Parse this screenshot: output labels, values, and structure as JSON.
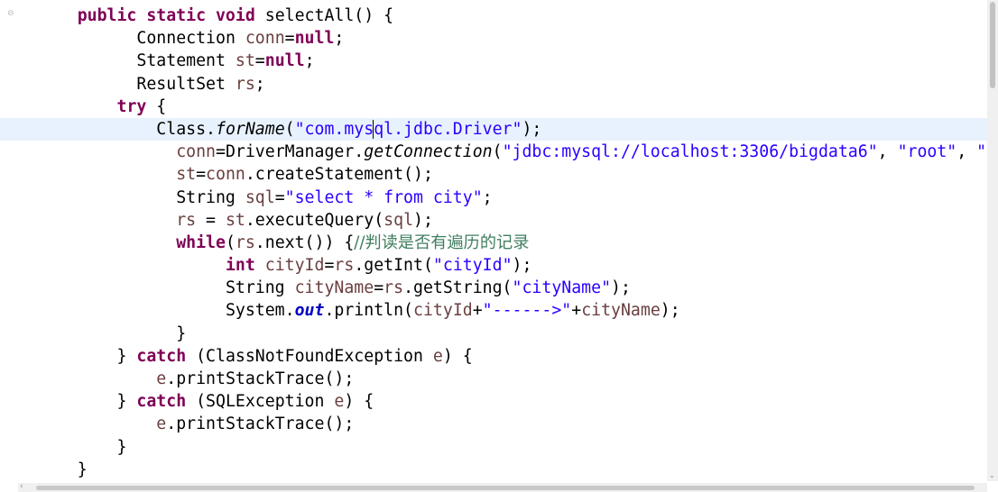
{
  "editor": {
    "gutter_marker": "⊖",
    "caret_line": 4,
    "lines": [
      {
        "indent": 6,
        "tokens": [
          {
            "t": "public static void",
            "c": "kw"
          },
          {
            "t": " selectAll() {",
            "c": ""
          }
        ]
      },
      {
        "indent": 12,
        "tokens": [
          {
            "t": "Connection ",
            "c": ""
          },
          {
            "t": "conn",
            "c": "var"
          },
          {
            "t": "=",
            "c": ""
          },
          {
            "t": "null",
            "c": "kw"
          },
          {
            "t": ";",
            "c": ""
          }
        ]
      },
      {
        "indent": 12,
        "tokens": [
          {
            "t": "Statement ",
            "c": ""
          },
          {
            "t": "st",
            "c": "var"
          },
          {
            "t": "=",
            "c": ""
          },
          {
            "t": "null",
            "c": "kw"
          },
          {
            "t": ";",
            "c": ""
          }
        ]
      },
      {
        "indent": 12,
        "tokens": [
          {
            "t": "ResultSet ",
            "c": ""
          },
          {
            "t": "rs",
            "c": "var"
          },
          {
            "t": ";",
            "c": ""
          }
        ]
      },
      {
        "indent": 10,
        "tokens": [
          {
            "t": "try",
            "c": "kw"
          },
          {
            "t": " {",
            "c": ""
          }
        ]
      },
      {
        "indent": 14,
        "current": true,
        "tokens": [
          {
            "t": "Class.",
            "c": ""
          },
          {
            "t": "forName",
            "c": "static-call"
          },
          {
            "t": "(",
            "c": ""
          },
          {
            "t": "\"com.mysql.jdbc.Driver\"",
            "c": "str"
          },
          {
            "t": ");",
            "c": ""
          }
        ]
      },
      {
        "indent": 16,
        "tokens": [
          {
            "t": "conn",
            "c": "var"
          },
          {
            "t": "=DriverManager.",
            "c": ""
          },
          {
            "t": "getConnection",
            "c": "static-call"
          },
          {
            "t": "(",
            "c": ""
          },
          {
            "t": "\"jdbc:mysql://localhost:3306/bigdata6\"",
            "c": "str"
          },
          {
            "t": ", ",
            "c": ""
          },
          {
            "t": "\"root\"",
            "c": "str"
          },
          {
            "t": ", ",
            "c": ""
          },
          {
            "t": "\"roc",
            "c": "str"
          }
        ]
      },
      {
        "indent": 16,
        "tokens": [
          {
            "t": "st",
            "c": "var"
          },
          {
            "t": "=",
            "c": ""
          },
          {
            "t": "conn",
            "c": "var"
          },
          {
            "t": ".createStatement();",
            "c": ""
          }
        ]
      },
      {
        "indent": 16,
        "tokens": [
          {
            "t": "String ",
            "c": ""
          },
          {
            "t": "sql",
            "c": "var"
          },
          {
            "t": "=",
            "c": ""
          },
          {
            "t": "\"select * from city\"",
            "c": "str"
          },
          {
            "t": ";",
            "c": ""
          }
        ]
      },
      {
        "indent": 16,
        "tokens": [
          {
            "t": "rs",
            "c": "var"
          },
          {
            "t": " = ",
            "c": ""
          },
          {
            "t": "st",
            "c": "var"
          },
          {
            "t": ".executeQuery(",
            "c": ""
          },
          {
            "t": "sql",
            "c": "var"
          },
          {
            "t": ");",
            "c": ""
          }
        ]
      },
      {
        "indent": 16,
        "tokens": [
          {
            "t": "while",
            "c": "kw"
          },
          {
            "t": "(",
            "c": ""
          },
          {
            "t": "rs",
            "c": "var"
          },
          {
            "t": ".next()) {",
            "c": ""
          },
          {
            "t": "//判读是否有遍历的记录",
            "c": "comment"
          }
        ]
      },
      {
        "indent": 21,
        "tokens": [
          {
            "t": "int",
            "c": "kw"
          },
          {
            "t": " ",
            "c": ""
          },
          {
            "t": "cityId",
            "c": "var"
          },
          {
            "t": "=",
            "c": ""
          },
          {
            "t": "rs",
            "c": "var"
          },
          {
            "t": ".getInt(",
            "c": ""
          },
          {
            "t": "\"cityId\"",
            "c": "str"
          },
          {
            "t": ");",
            "c": ""
          }
        ]
      },
      {
        "indent": 21,
        "tokens": [
          {
            "t": "String ",
            "c": ""
          },
          {
            "t": "cityName",
            "c": "var"
          },
          {
            "t": "=",
            "c": ""
          },
          {
            "t": "rs",
            "c": "var"
          },
          {
            "t": ".getString(",
            "c": ""
          },
          {
            "t": "\"cityName\"",
            "c": "str"
          },
          {
            "t": ");",
            "c": ""
          }
        ]
      },
      {
        "indent": 21,
        "tokens": [
          {
            "t": "System.",
            "c": ""
          },
          {
            "t": "out",
            "c": "field"
          },
          {
            "t": ".println(",
            "c": ""
          },
          {
            "t": "cityId",
            "c": "var"
          },
          {
            "t": "+",
            "c": ""
          },
          {
            "t": "\"------>\"",
            "c": "str"
          },
          {
            "t": "+",
            "c": ""
          },
          {
            "t": "cityName",
            "c": "var"
          },
          {
            "t": ");",
            "c": ""
          }
        ]
      },
      {
        "indent": 16,
        "tokens": [
          {
            "t": "}",
            "c": ""
          }
        ]
      },
      {
        "indent": 10,
        "tokens": [
          {
            "t": "} ",
            "c": ""
          },
          {
            "t": "catch",
            "c": "kw"
          },
          {
            "t": " (ClassNotFoundException ",
            "c": ""
          },
          {
            "t": "e",
            "c": "var"
          },
          {
            "t": ") {",
            "c": ""
          }
        ]
      },
      {
        "indent": 14,
        "tokens": [
          {
            "t": "e",
            "c": "var"
          },
          {
            "t": ".printStackTrace();",
            "c": ""
          }
        ]
      },
      {
        "indent": 10,
        "tokens": [
          {
            "t": "} ",
            "c": ""
          },
          {
            "t": "catch",
            "c": "kw"
          },
          {
            "t": " (SQLException ",
            "c": ""
          },
          {
            "t": "e",
            "c": "var"
          },
          {
            "t": ") {",
            "c": ""
          }
        ]
      },
      {
        "indent": 14,
        "tokens": [
          {
            "t": "e",
            "c": "var"
          },
          {
            "t": ".printStackTrace();",
            "c": ""
          }
        ]
      },
      {
        "indent": 10,
        "tokens": [
          {
            "t": "}",
            "c": ""
          }
        ]
      },
      {
        "indent": 6,
        "tokens": [
          {
            "t": "}",
            "c": ""
          }
        ]
      }
    ]
  },
  "scrollbars": {
    "vertical_down_arrow": "⌄",
    "horizontal_left_arrow": "‹"
  },
  "colors": {
    "keyword": "#7f0055",
    "string": "#2a00ff",
    "local_variable": "#6a3e3e",
    "static_field": "#0000c0",
    "comment": "#3f7f5f",
    "current_line_highlight": "#e8f2fe"
  }
}
